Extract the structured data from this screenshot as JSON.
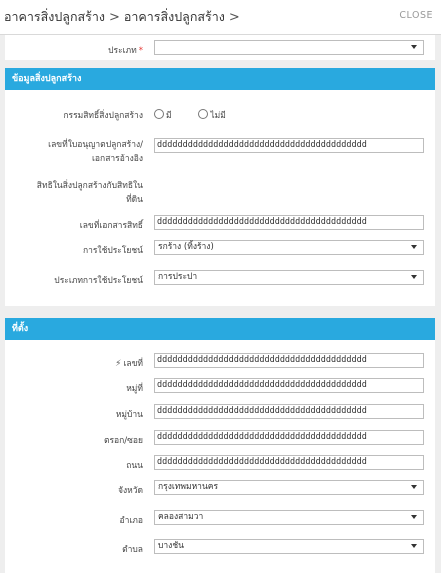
{
  "header": {
    "crumb_1": "อาคารสิ่งปลูกสร้าง",
    "crumb_2": "อาคารสิ่งปลูกสร้าง",
    "close": "CLOSE"
  },
  "type_field": {
    "label": "ประเภท",
    "required_mark": "*",
    "value": ""
  },
  "building_section": {
    "title": "ข้อมูลสิ่งปลูกสร้าง",
    "ownership": {
      "label": "กรรมสิทธิ์สิ่งปลูกสร้าง",
      "option_yes": "มี",
      "option_no": "ไม่มี"
    },
    "permit_no": {
      "label_line1": "เลขที่ใบอนุญาตปลูกสร้าง/",
      "label_line2": "เอกสารอ้างอิง",
      "value": "ddddddddddddddddddddddddddddddddddddddddd"
    },
    "rights_on_land": {
      "label_line1": "สิทธิในสิ่งปลูกสร้างกับสิทธิใน",
      "label_line2": "ที่ดิน"
    },
    "title_doc_no": {
      "label": "เลขที่เอกสารสิทธิ์",
      "value": "ddddddddddddddddddddddddddddddddddddddddd"
    },
    "usage": {
      "label": "การใช้ประโยชน์",
      "value": "รกร้าง (ทิ้งร้าง)"
    },
    "usage_type": {
      "label": "ประเภทการใช้ประโยชน์",
      "value": "การประปา"
    }
  },
  "location_section": {
    "title": "ที่ตั้ง",
    "house_no": {
      "label": "เลขที่",
      "value": "ddddddddddddddddddddddddddddddddddddddddd"
    },
    "moo": {
      "label": "หมู่ที่",
      "value": "ddddddddddddddddddddddddddddddddddddddddd"
    },
    "village": {
      "label": "หมู่บ้าน",
      "value": "ddddddddddddddddddddddddddddddddddddddddd"
    },
    "soi": {
      "label": "ตรอก/ซอย",
      "value": "ddddddddddddddddddddddddddddddddddddddddd"
    },
    "road": {
      "label": "ถนน",
      "value": "ddddddddddddddddddddddddddddddddddddddddd"
    },
    "province": {
      "label": "จังหวัด",
      "value": "กรุงเทพมหานคร"
    },
    "district": {
      "label": "อำเภอ",
      "value": "คลองสามวา"
    },
    "subdistrict": {
      "label": "ตำบล",
      "value": "บางชัน"
    }
  }
}
